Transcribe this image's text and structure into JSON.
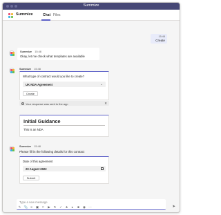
{
  "window": {
    "title": "Summize"
  },
  "app": {
    "name": "Summize",
    "tabs": [
      {
        "label": "Chat",
        "active": true
      },
      {
        "label": "Files",
        "active": false
      }
    ],
    "logo_colors": [
      "#E94F6F",
      "#F2B632",
      "#3BB4E5",
      "#6CC04A"
    ]
  },
  "messages": {
    "sent": {
      "time": "15:48",
      "text": "Create"
    },
    "bot1": {
      "sender": "Summize",
      "time": "15:48",
      "text": "Okay, let me check what templates are available"
    },
    "bot2": {
      "sender": "Summize",
      "time": "15:48",
      "question": "What type of contract would you like to create?",
      "selected": "UK NDA Agreement",
      "button": "Create",
      "notice": "Your response was sent to the app"
    },
    "guidance": {
      "title": "Initial Guidance",
      "body": "This is an NDA"
    },
    "bot3": {
      "sender": "Summize",
      "time": "15:48",
      "text": "Please fill in the following details for this contract",
      "field_label": "Date of this agreement",
      "date_value": "20 August 2022",
      "button": "Submit"
    }
  },
  "composer": {
    "placeholder": "Type a new message",
    "tools": [
      "format",
      "attach",
      "emoji",
      "gif",
      "sticker",
      "meet",
      "loop",
      "approvals",
      "praise",
      "stream",
      "summize",
      "updates",
      "more"
    ]
  }
}
